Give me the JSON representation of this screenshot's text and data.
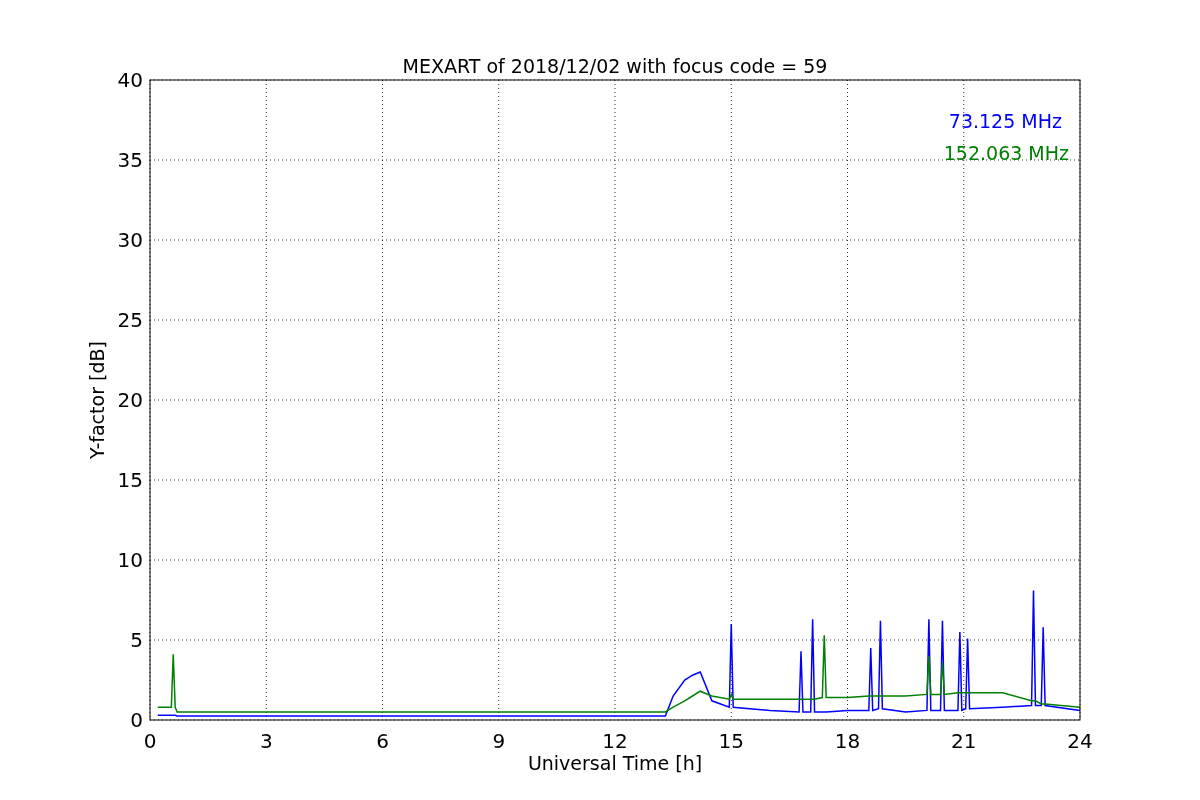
{
  "figure": {
    "chart_data": {
      "type": "line",
      "grid": true,
      "title": "MEXART of 2018/12/02 with focus code = 59",
      "xlabel": "Universal Time [h]",
      "ylabel": "Y-factor [dB]",
      "xlim": [
        0,
        24
      ],
      "ylim": [
        0,
        40
      ],
      "xticks": [
        0,
        3,
        6,
        9,
        12,
        15,
        18,
        21,
        24
      ],
      "yticks": [
        0,
        5,
        10,
        15,
        20,
        25,
        30,
        35,
        40
      ],
      "x": [
        0.2,
        0.4,
        0.55,
        0.6,
        0.65,
        0.7,
        13.3,
        13.5,
        13.8,
        14.0,
        14.2,
        14.5,
        14.95,
        15.0,
        15.05,
        16,
        16.75,
        16.8,
        16.85,
        17.05,
        17.1,
        17.15,
        17.35,
        17.4,
        17.45,
        18,
        18.55,
        18.6,
        18.65,
        18.8,
        18.85,
        18.9,
        19.5,
        20.05,
        20.1,
        20.15,
        20.4,
        20.45,
        20.5,
        20.85,
        20.9,
        20.95,
        21.05,
        21.1,
        21.15,
        22,
        22.75,
        22.8,
        22.85,
        23.0,
        23.05,
        23.1,
        24
      ],
      "series": [
        {
          "name": "73.125 MHz",
          "color": "#0000ff",
          "values": [
            0.3,
            0.3,
            0.3,
            0.3,
            0.3,
            0.25,
            0.25,
            1.5,
            2.5,
            2.8,
            3.0,
            1.2,
            0.8,
            6.0,
            0.8,
            0.6,
            0.5,
            4.3,
            0.5,
            0.5,
            6.3,
            0.5,
            0.5,
            0.5,
            0.5,
            0.6,
            0.6,
            4.5,
            0.6,
            0.7,
            6.2,
            0.7,
            0.5,
            0.6,
            6.3,
            0.6,
            0.6,
            6.2,
            0.6,
            0.6,
            5.5,
            0.6,
            0.7,
            5.1,
            0.7,
            0.8,
            0.9,
            8.1,
            0.9,
            0.9,
            5.8,
            0.9,
            0.6
          ]
        },
        {
          "name": "152.063 MHz",
          "color": "#008000",
          "values": [
            0.8,
            0.8,
            0.8,
            4.1,
            0.8,
            0.5,
            0.5,
            0.8,
            1.2,
            1.5,
            1.8,
            1.5,
            1.3,
            1.6,
            1.3,
            1.3,
            1.3,
            1.3,
            1.3,
            1.3,
            1.3,
            1.3,
            1.4,
            5.3,
            1.4,
            1.4,
            1.5,
            1.5,
            1.5,
            1.5,
            1.5,
            1.5,
            1.5,
            1.6,
            4.0,
            1.6,
            1.6,
            3.6,
            1.6,
            1.7,
            1.7,
            1.7,
            1.7,
            1.7,
            1.7,
            1.7,
            1.2,
            1.2,
            1.2,
            1.0,
            1.0,
            1.0,
            0.8
          ]
        }
      ]
    }
  }
}
